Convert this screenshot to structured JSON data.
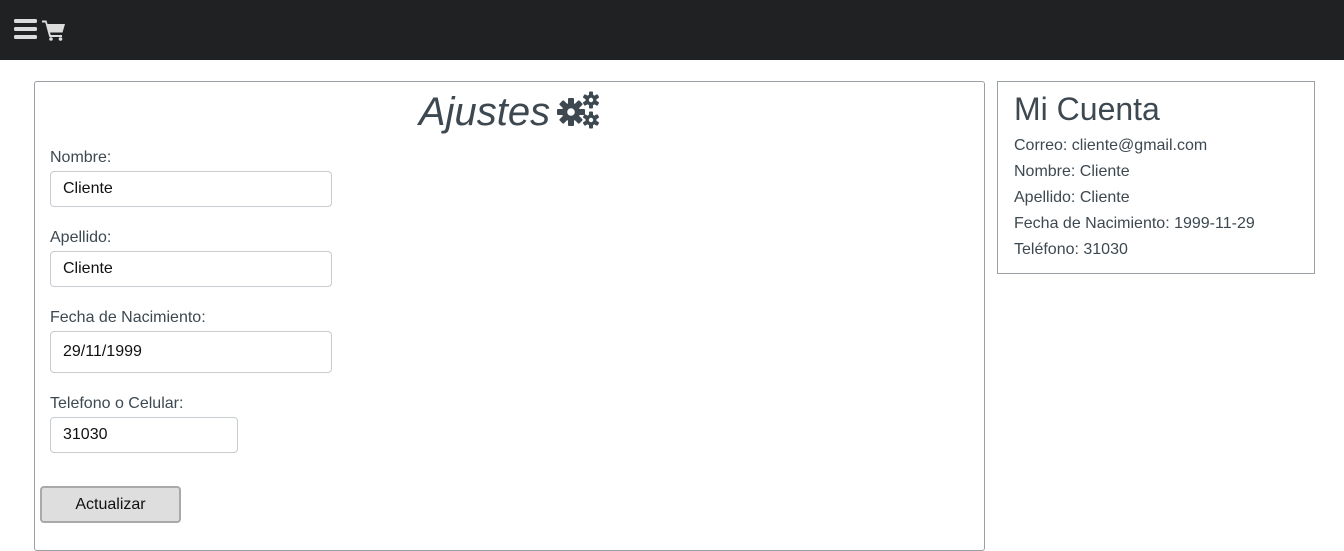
{
  "topbar": {
    "menu_icon": "hamburger-menu-icon",
    "cart_icon": "shopping-cart-icon",
    "background": "#1f2123"
  },
  "settings": {
    "title": "Ajustes",
    "title_icon": "gears-icon",
    "fields": {
      "nombre": {
        "label": "Nombre:",
        "value": "Cliente"
      },
      "apellido": {
        "label": "Apellido:",
        "value": "Cliente"
      },
      "fecha": {
        "label": "Fecha de Nacimiento:",
        "value": "29/11/1999"
      },
      "telefono": {
        "label": "Telefono o Celular:",
        "value": "31030"
      }
    },
    "update_label": "Actualizar"
  },
  "account": {
    "title": "Mi Cuenta",
    "lines": {
      "correo": "Correo: cliente@gmail.com",
      "nombre": "Nombre: Cliente",
      "apellido": "Apellido: Cliente",
      "fecha": "Fecha de Nacimiento: 1999-11-29",
      "telefono": "Teléfono: 31030"
    }
  },
  "colors": {
    "text": "#3d4850",
    "border": "#9aa0a4",
    "button_bg": "#dedede"
  }
}
